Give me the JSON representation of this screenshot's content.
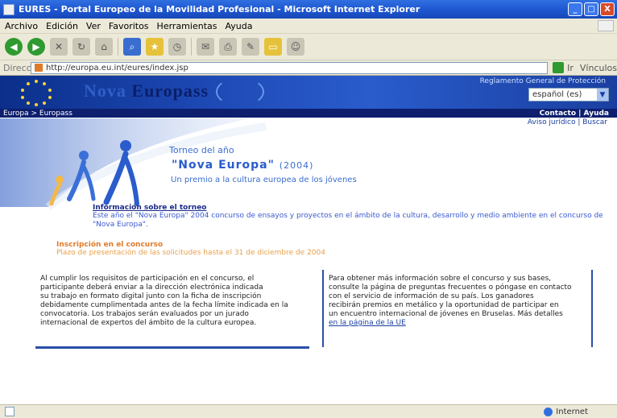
{
  "window": {
    "title": "EURES - Portal Europeo de la Movilidad Profesional - Microsoft Internet Explorer",
    "min": "_",
    "max": "□",
    "close": "X"
  },
  "menu": {
    "items": [
      "Archivo",
      "Edición",
      "Ver",
      "Favoritos",
      "Herramientas",
      "Ayuda"
    ]
  },
  "toolbar": {
    "back": "Atrás",
    "search": "Búsqueda",
    "favorites": "Favoritos"
  },
  "address": {
    "label": "Dirección",
    "value": "http://europa.eu.int/eures/index.jsp",
    "go": "Ir",
    "links": "Vínculos"
  },
  "banner": {
    "brand_prefix": "Nova",
    "brand": "Europass",
    "toplink": "Reglamento General de Protección",
    "language": "español (es)"
  },
  "nav": {
    "crumb": "Europa > Europass",
    "right": "Contacto | Ayuda",
    "sub": "Aviso jurídico | Buscar"
  },
  "hero": {
    "title1": "Torneo del año",
    "title2": "\"Nova Europa\"",
    "title2_paren": "(2004)",
    "subtitle": "Un premio a la cultura europea de los jóvenes"
  },
  "section1": {
    "head": "Información sobre el torneo",
    "body": "Este año el \"Nova Europa\" 2004 concurso de ensayos y proyectos en el ámbito de la cultura, desarrollo y medio ambiente en el concurso de \"Nova Europa\"."
  },
  "section2": {
    "head": "Inscripción en el concurso",
    "body": "Plazo de presentación de las solicitudes hasta el 31 de diciembre de 2004"
  },
  "box_left": {
    "lines": [
      "Al cumplir los requisitos de participación en el concurso, el",
      "participante deberá enviar a la dirección electrónica indicada",
      "su trabajo en formato digital junto con la ficha de inscripción",
      "debidamente cumplimentada antes de la fecha límite indicada en la",
      "convocatoria. Los trabajos serán evaluados por un jurado",
      "internacional de expertos del ámbito de la cultura europea."
    ]
  },
  "box_right": {
    "lines": [
      "Para obtener más información sobre el concurso y sus bases,",
      "consulte la página de preguntas frecuentes o póngase en contacto",
      "con el servicio de información de su país. Los ganadores",
      "recibirán premios en metálico y la oportunidad de participar en",
      "un encuentro internacional de jóvenes en Bruselas. Más detalles"
    ],
    "link": "en la página de la UE"
  },
  "status": {
    "zone": "Internet"
  }
}
